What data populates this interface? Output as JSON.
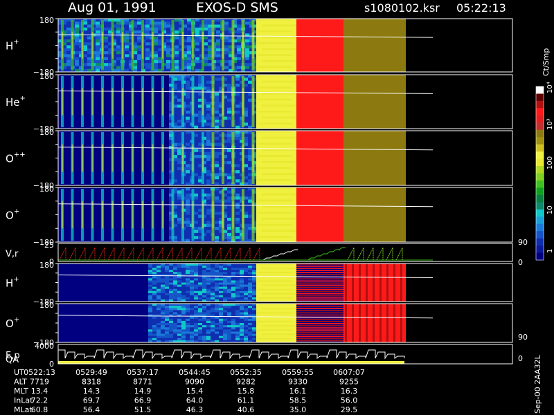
{
  "header": {
    "date": "Aug 01, 1991",
    "instrument": "EXOS-D SMS",
    "file": "s1080102.ksr",
    "time": "05:22:13"
  },
  "colorbar": {
    "unit": "Ct/Smp",
    "ticks": [
      "1",
      "10",
      "100",
      "10³",
      "10⁴"
    ],
    "colors": [
      "#000080",
      "#0a1a9a",
      "#0f2fb0",
      "#1555c8",
      "#1a7ad8",
      "#1aa0d8",
      "#10c8c8",
      "#0e8a6a",
      "#0a8040",
      "#10a020",
      "#40c020",
      "#80d020",
      "#b0d820",
      "#e8e830",
      "#f0f040",
      "#d0c020",
      "#a09010",
      "#8c7a10",
      "#c03030",
      "#e02020",
      "#ff1a1a",
      "#b01010",
      "#600000",
      "#ffffff"
    ]
  },
  "side_labels": {
    "pitch_top": "90",
    "pitch_bottom": "0",
    "energy_top": "90",
    "energy_bottom": "0"
  },
  "footer": {
    "stamp": "Sep-00 2AA32L",
    "row_labels": [
      "UT",
      "ALT",
      "MLT",
      "InLat",
      "MLat"
    ],
    "columns": [
      {
        "UT": "0522:13",
        "ALT": "7719",
        "MLT": "13.4",
        "InLat": "72.2",
        "MLat": "60.8"
      },
      {
        "UT": "0529:49",
        "ALT": "8318",
        "MLT": "14.3",
        "InLat": "69.7",
        "MLat": "56.4"
      },
      {
        "UT": "0537:17",
        "ALT": "8771",
        "MLT": "14.9",
        "InLat": "66.9",
        "MLat": "51.5"
      },
      {
        "UT": "0544:45",
        "ALT": "9090",
        "MLT": "15.4",
        "InLat": "64.0",
        "MLat": "46.3"
      },
      {
        "UT": "0552:35",
        "ALT": "9282",
        "MLT": "15.8",
        "InLat": "61.1",
        "MLat": "40.6"
      },
      {
        "UT": "0559:55",
        "ALT": "9330",
        "MLT": "16.1",
        "InLat": "58.5",
        "MLat": "35.0"
      },
      {
        "UT": "0607:07",
        "ALT": "9255",
        "MLT": "16.3",
        "InLat": "56.0",
        "MLat": "29.5"
      }
    ]
  },
  "chart_data": [
    {
      "type": "heatmap",
      "panel": "H+",
      "label": "H",
      "charge": "+",
      "ylim": [
        -180,
        180
      ],
      "yticks": [
        "180",
        "−180"
      ]
    },
    {
      "type": "heatmap",
      "panel": "He+",
      "label": "He",
      "charge": "+",
      "ylim": [
        -180,
        180
      ],
      "yticks": [
        "180",
        "−180"
      ]
    },
    {
      "type": "heatmap",
      "panel": "O++",
      "label": "O",
      "charge": "++",
      "ylim": [
        -180,
        180
      ],
      "yticks": [
        "180",
        "−180"
      ]
    },
    {
      "type": "heatmap",
      "panel": "O+",
      "label": "O",
      "charge": "+",
      "ylim": [
        -180,
        180
      ],
      "yticks": [
        "180",
        "−180"
      ]
    },
    {
      "type": "line",
      "panel": "V,r",
      "label": "V,r",
      "ylim": [
        0,
        25
      ],
      "yticks": [
        "25",
        "0"
      ]
    },
    {
      "type": "heatmap",
      "panel": "H+ (2)",
      "label": "H",
      "charge": "+",
      "ylim": [
        -180,
        180
      ],
      "yticks": [
        "180",
        "−180"
      ]
    },
    {
      "type": "heatmap",
      "panel": "O+ (2)",
      "label": "O",
      "charge": "+",
      "ylim": [
        -180,
        180
      ],
      "yticks": [
        "180",
        "−180"
      ]
    },
    {
      "type": "line",
      "panel": "E,p QA",
      "label": "E,p",
      "label2": "QA",
      "ylim": [
        0,
        4000
      ],
      "yticks": [
        "4000",
        "0"
      ]
    }
  ]
}
